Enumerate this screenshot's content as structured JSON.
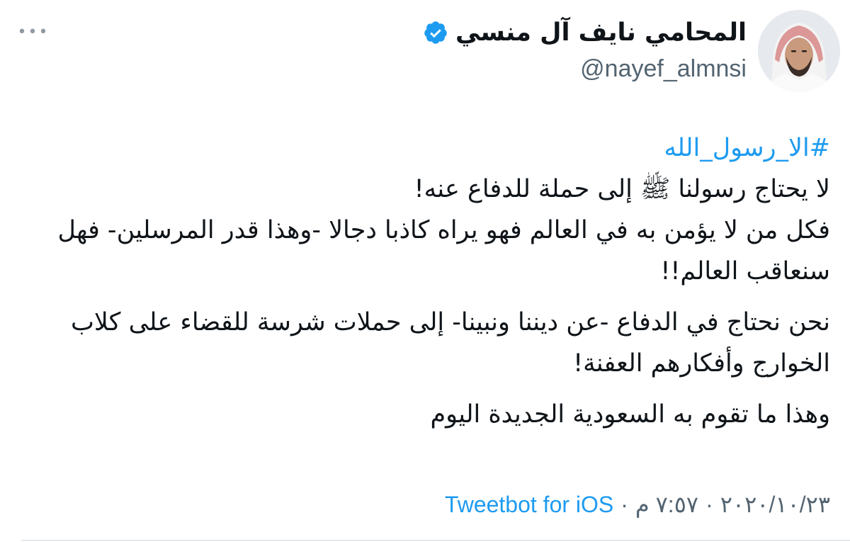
{
  "author": {
    "display_name": "المحامي نايف آل منسي",
    "handle": "@nayef_almnsi",
    "verified_icon": "verified-badge-icon"
  },
  "more_icon": "ellipsis-icon",
  "tweet": {
    "hashtag": "#الا_رسول_الله",
    "lines": [
      "لا يحتاج رسولنا ﷺ إلى حملة للدفاع عنه!",
      "فكل من لا يؤمن به في العالم فهو يراه كاذبا دجالا -وهذا قدر المرسلين- فهل سنعاقب العالم!!",
      "نحن نحتاج في الدفاع -عن ديننا ونبينا- إلى حملات شرسة للقضاء على كلاب الخوارج وأفكارهم العفنة!",
      "وهذا ما تقوم به السعودية الجديدة اليوم"
    ]
  },
  "meta": {
    "date": "٢٠٢٠/١٠/٢٣",
    "separator": "·",
    "time": "٧:٥٧ م",
    "source": "Tweetbot for iOS"
  },
  "colors": {
    "link": "#1d9bf0",
    "text": "#0f1419",
    "secondary": "#536471"
  }
}
